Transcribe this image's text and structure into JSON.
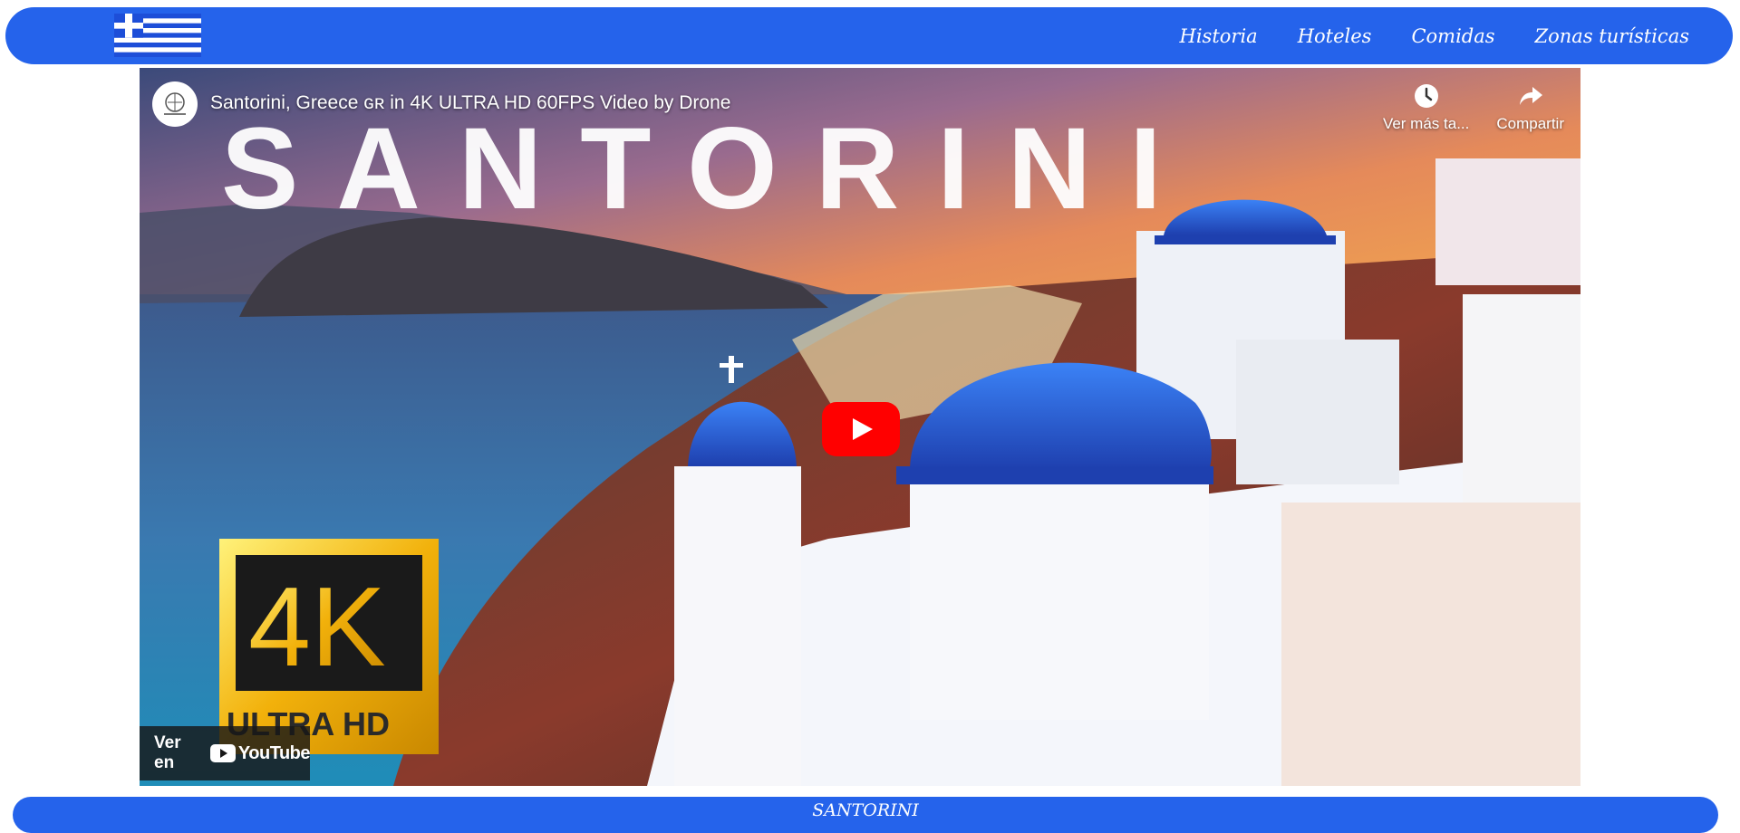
{
  "colors": {
    "accent": "#2563eb",
    "flag_blue": "#1d4ed8",
    "youtube_red": "#ff0000"
  },
  "nav": {
    "flag_icon": "greece-flag-icon",
    "links": [
      {
        "label": "Historia"
      },
      {
        "label": "Hoteles"
      },
      {
        "label": "Comidas"
      },
      {
        "label": "Zonas turísticas"
      }
    ]
  },
  "video": {
    "title": "Santorini, Greece ɢʀ in 4K ULTRA HD 60FPS Video by Drone",
    "thumbnail_text": "SANTORINI",
    "badge_main": "4K",
    "badge_sub": "ULTRA HD",
    "watch_later_label": "Ver más ta...",
    "share_label": "Compartir",
    "watch_on_label": "Ver en",
    "youtube_label": "YouTube",
    "icons": {
      "watch_later": "clock-icon",
      "share": "share-arrow-icon",
      "play": "play-icon",
      "channel": "channel-avatar-icon"
    }
  },
  "footer": {
    "title": "SANTORINI"
  }
}
